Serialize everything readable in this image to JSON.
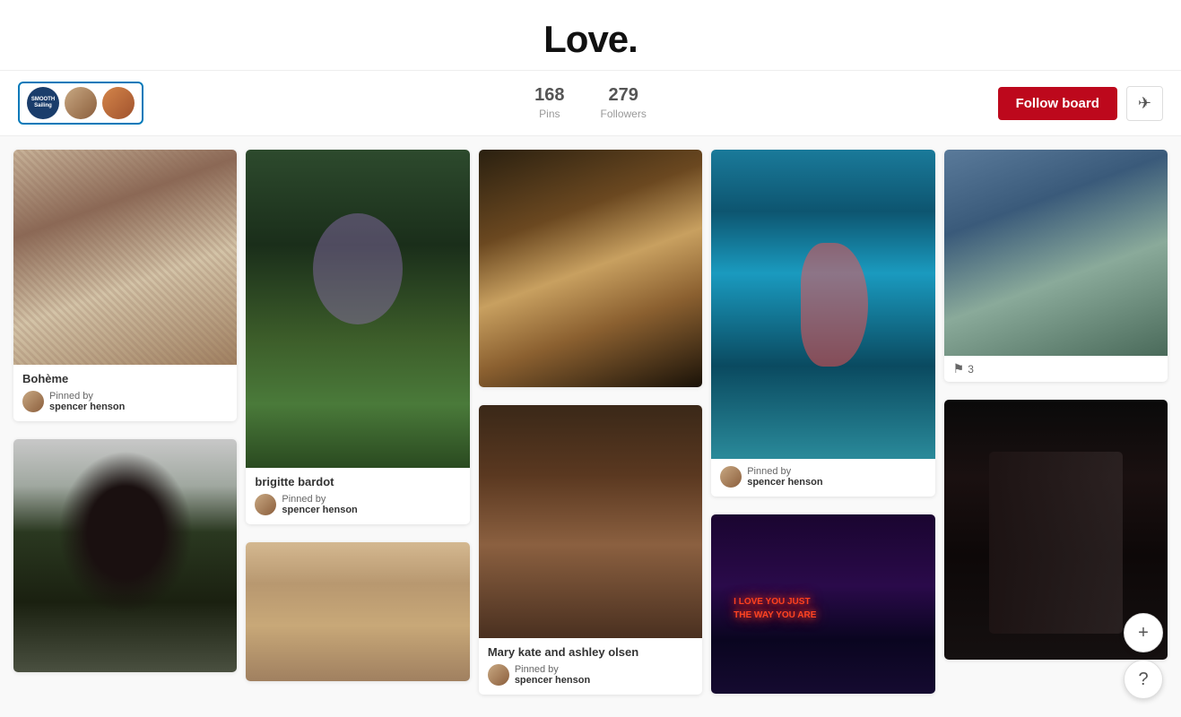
{
  "header": {
    "title": "Love."
  },
  "board_meta": {
    "stats": {
      "pins": {
        "count": "168",
        "label": "Pins"
      },
      "followers": {
        "count": "279",
        "label": "Followers"
      }
    },
    "follow_button_label": "Follow board",
    "send_icon": "✈"
  },
  "pins": [
    {
      "id": "boho",
      "title": "Bohème",
      "has_title": true,
      "pinned_by_label": "Pinned by",
      "pinner": "spencer henson",
      "image_class": "img-boho"
    },
    {
      "id": "brigitte",
      "title": "brigitte bardot",
      "has_title": true,
      "pinned_by_label": "Pinned by",
      "pinner": "spencer henson",
      "image_class": "img-brigitte"
    },
    {
      "id": "mk1",
      "title": "",
      "has_title": false,
      "pinned_by_label": "",
      "pinner": "",
      "image_class": "img-mk1"
    },
    {
      "id": "mk2",
      "title": "Mary kate and ashley olsen",
      "has_title": true,
      "pinned_by_label": "Pinned by",
      "pinner": "spencer henson",
      "image_class": "img-mk2"
    },
    {
      "id": "underwater",
      "title": "",
      "has_title": false,
      "pinned_by_label": "Pinned by",
      "pinner": "spencer henson",
      "image_class": "img-underwater"
    },
    {
      "id": "couple",
      "title": "",
      "has_title": false,
      "pinned_by_label": "",
      "pinner": "",
      "image_class": "img-couple",
      "count_badge": "3"
    },
    {
      "id": "neon",
      "title": "",
      "has_title": false,
      "pinned_by_label": "",
      "pinner": "",
      "image_class": "img-neon"
    },
    {
      "id": "lana",
      "title": "",
      "has_title": false,
      "pinned_by_label": "",
      "pinner": "",
      "image_class": "img-lana"
    },
    {
      "id": "bed",
      "title": "",
      "has_title": false,
      "pinned_by_label": "",
      "pinner": "",
      "image_class": "img-bed"
    },
    {
      "id": "darkcouple",
      "title": "",
      "has_title": false,
      "pinned_by_label": "",
      "pinner": "",
      "image_class": "img-darkcouple"
    }
  ],
  "floating": {
    "add_icon": "+",
    "help_icon": "?"
  }
}
